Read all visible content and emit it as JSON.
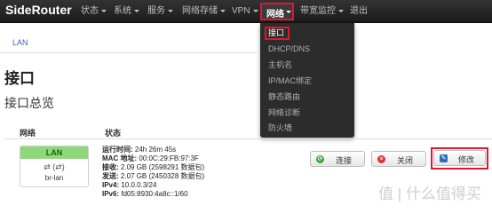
{
  "navbar": {
    "brand": "SideRouter",
    "items": [
      {
        "label": "状态"
      },
      {
        "label": "系统"
      },
      {
        "label": "服务"
      },
      {
        "label": "网络存储"
      },
      {
        "label": "VPN"
      },
      {
        "label": "网络"
      },
      {
        "label": "带宽监控"
      },
      {
        "label": "退出"
      }
    ]
  },
  "dropdown": {
    "items": [
      "接口",
      "DHCP/DNS",
      "主机名",
      "IP/MAC绑定",
      "静态路由",
      "网络诊断",
      "防火墙"
    ]
  },
  "breadcrumb": {
    "current": "LAN"
  },
  "page": {
    "title": "接口",
    "section": "接口总览"
  },
  "table": {
    "col_network": "网络",
    "col_status": "状态",
    "iface": {
      "name": "LAN",
      "icons": "⇄ (⇄)",
      "device": "br-lan"
    },
    "status": {
      "uptime_label": "运行时间:",
      "uptime": "24h 26m 45s",
      "mac_label": "MAC 地址:",
      "mac": "00:0C:29:FB:97:3F",
      "rx_label": "接收:",
      "rx": "2.09 GB (2598291 数据包)",
      "tx_label": "发送:",
      "tx": "2.07 GB (2450328 数据包)",
      "ipv4_label": "IPv4:",
      "ipv4": "10.0.0.3/24",
      "ipv6_label": "IPv6:",
      "ipv6": "fd05:8930:4a8c::1/60"
    }
  },
  "actions": {
    "connect": "连接",
    "close": "关闭",
    "edit": "修改"
  },
  "colors": {
    "accent_red": "#e0182c",
    "lan_green": "#8fd77a",
    "link_blue": "#2a6ebb",
    "navbar_bg": "#222222"
  },
  "watermark": "值 | 什么值得买"
}
